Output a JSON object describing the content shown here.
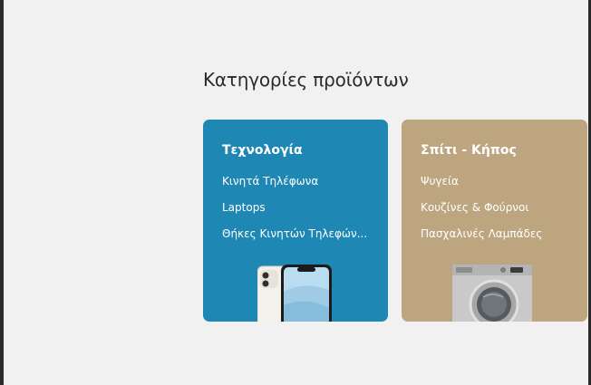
{
  "section": {
    "title": "Κατηγορίες προϊόντων"
  },
  "colors": {
    "tech_card": "#1f87b3",
    "home_card": "#bda67f",
    "background": "#f1f1f1"
  },
  "cards": [
    {
      "title": "Τεχνολογία",
      "links": [
        "Κινητά Τηλέφωνα",
        "Laptops",
        "Θήκες Κινητών Τηλεφών..."
      ],
      "image_icon": "smartphone-image"
    },
    {
      "title": "Σπίτι - Κήπος",
      "links": [
        "Ψυγεία",
        "Κουζίνες & Φούρνοι",
        "Πασχαλινές Λαμπάδες"
      ],
      "image_icon": "washing-machine-image"
    }
  ]
}
